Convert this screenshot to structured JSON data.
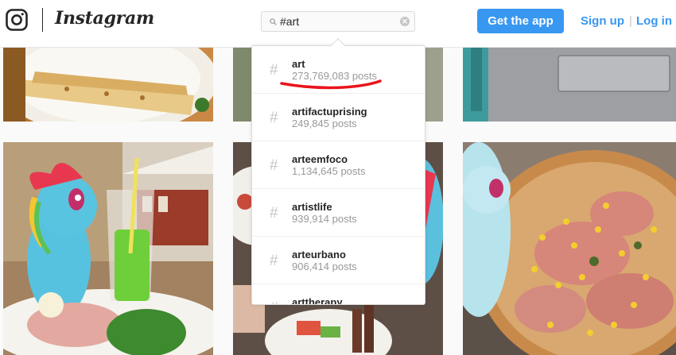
{
  "header": {
    "brand": "Instagram",
    "search_value": "#art",
    "get_app_label": "Get the app",
    "signup_label": "Sign up",
    "auth_separator": "|",
    "login_label": "Log in",
    "clear_glyph": "✕"
  },
  "search_results": [
    {
      "hash": "#",
      "tag": "art",
      "count": "273,769,083 posts"
    },
    {
      "hash": "#",
      "tag": "artifactuprising",
      "count": "249,845 posts"
    },
    {
      "hash": "#",
      "tag": "arteemfoco",
      "count": "1,134,645 posts"
    },
    {
      "hash": "#",
      "tag": "artistlife",
      "count": "939,914 posts"
    },
    {
      "hash": "#",
      "tag": "arteurbano",
      "count": "906,414 posts"
    },
    {
      "hash": "#",
      "tag": "arttherapy",
      "count": ""
    }
  ],
  "colors": {
    "accent": "#3897f0",
    "underline_annotation": "#e8151b",
    "header_bg": "#ffffff",
    "page_bg": "#fafafa"
  },
  "icons": [
    "instagram-camera-icon",
    "search-icon",
    "clear-search-icon",
    "hashtag-icon"
  ]
}
